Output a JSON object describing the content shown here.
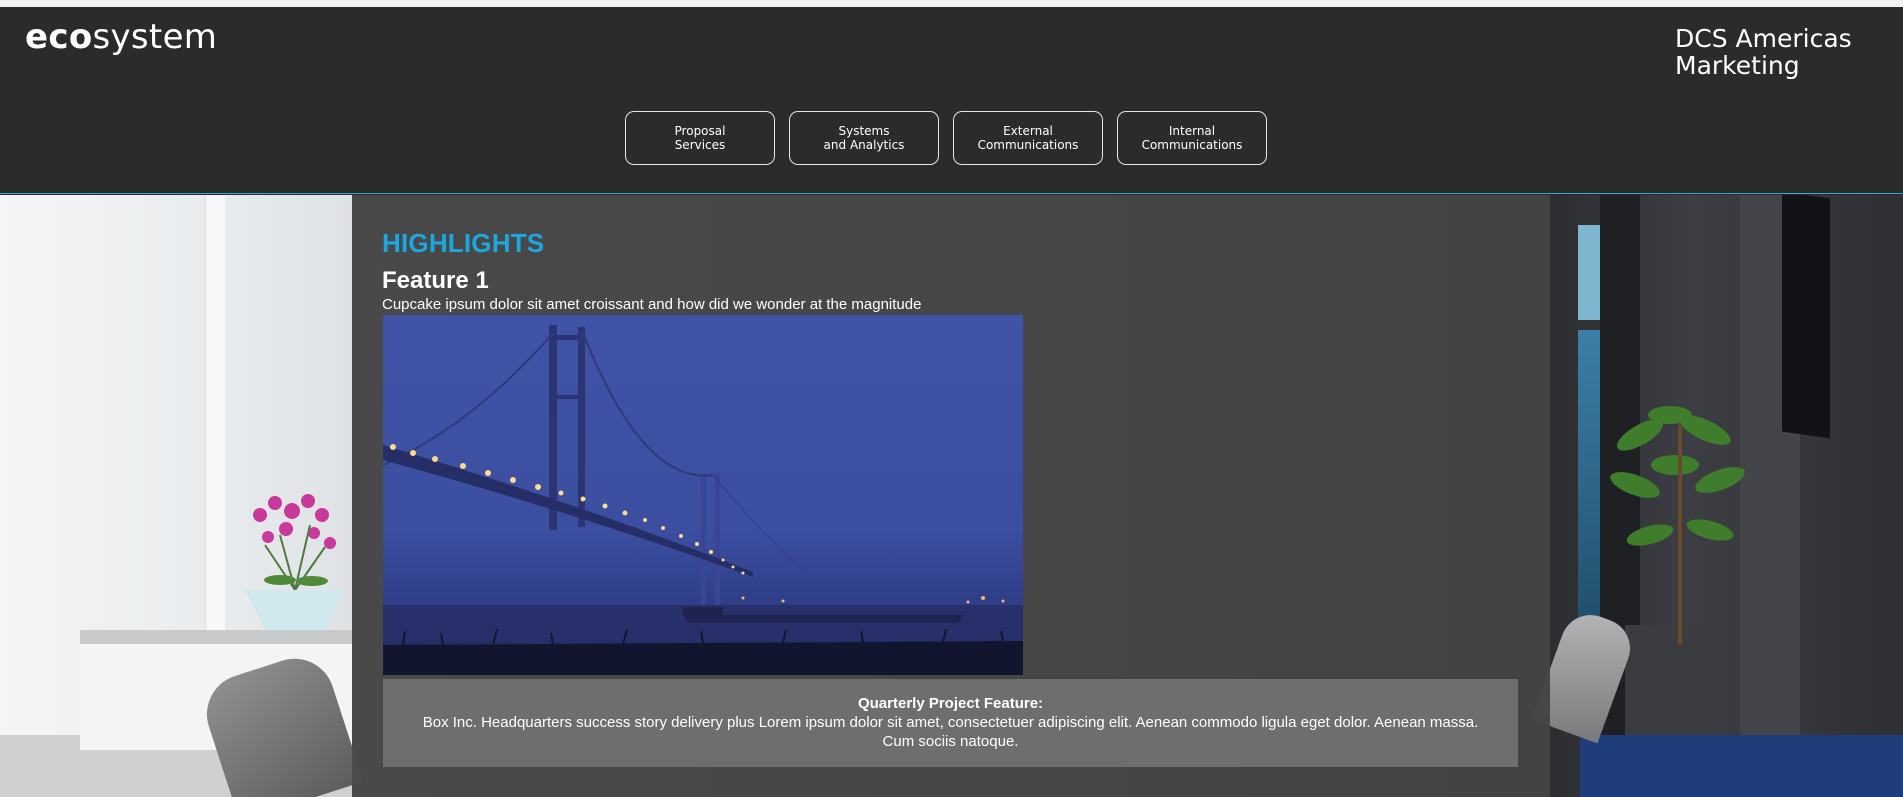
{
  "header": {
    "logo_bold": "eco",
    "logo_rest": "system",
    "org_line1": "DCS Americas",
    "org_line2": "Marketing"
  },
  "nav": {
    "items": [
      {
        "label": "Proposal\nServices"
      },
      {
        "label": "Systems\nand Analytics"
      },
      {
        "label": "External\nCommunications"
      },
      {
        "label": "Internal\nCommunications"
      }
    ]
  },
  "highlights": {
    "title": "HIGHLIGHTS",
    "feature_title": "Feature 1",
    "feature_subtitle": "Cupcake ipsum dolor sit amet croissant and how did we wonder at the magnitude",
    "image_subject": "bridge-at-dusk-image"
  },
  "caption": {
    "title": "Quarterly Project Feature:",
    "text": "Box Inc. Headquarters success story delivery plus Lorem ipsum dolor sit amet, consectetuer adipiscing elit. Aenean commodo ligula eget dolor. Aenean massa. Cum sociis natoque."
  },
  "colors": {
    "header_bg": "#2b2b2b",
    "accent": "#1ba7e0",
    "caption_bg": "#6e6e6e"
  }
}
